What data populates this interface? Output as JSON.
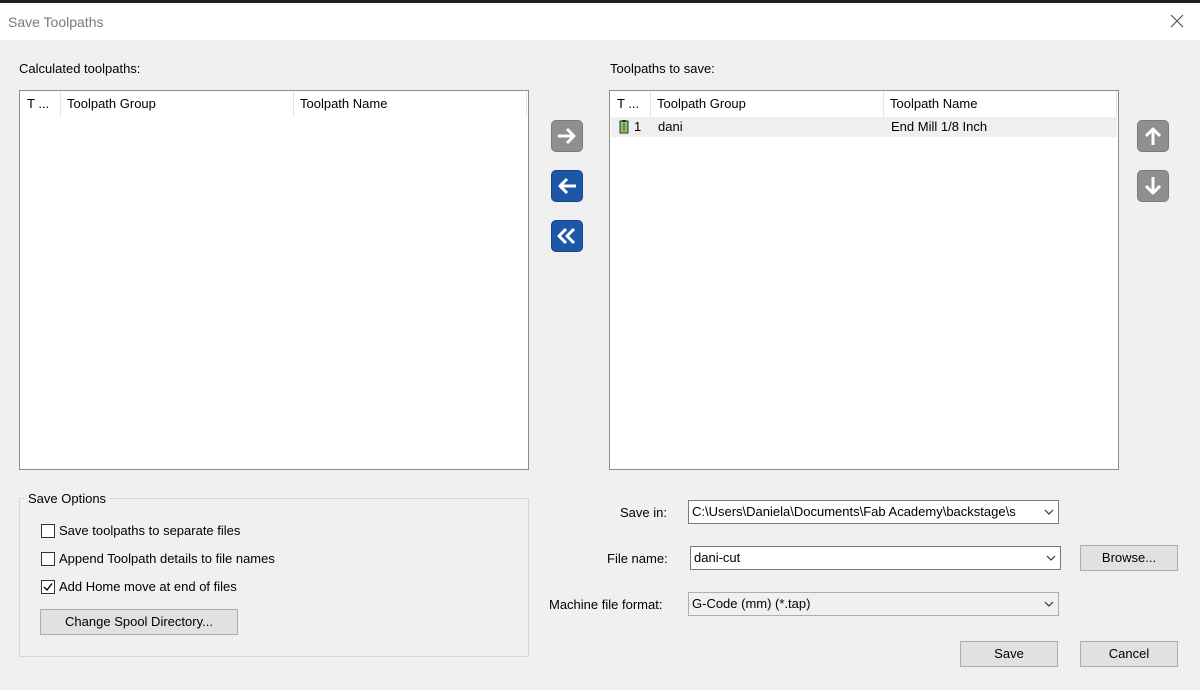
{
  "window": {
    "title": "Save Toolpaths"
  },
  "calculated": {
    "label": "Calculated toolpaths:",
    "columns": [
      "T ...",
      "Toolpath Group",
      "Toolpath Name"
    ]
  },
  "to_save": {
    "label": "Toolpaths to save:",
    "columns": [
      "T ...",
      "Toolpath Group",
      "Toolpath Name"
    ],
    "rows": [
      {
        "tool": "1",
        "group": "dani",
        "name": "End Mill 1/8 Inch"
      }
    ]
  },
  "options": {
    "title": "Save Options",
    "separate_files": {
      "label": "Save toolpaths to separate files",
      "checked": false
    },
    "append_details": {
      "label": "Append Toolpath details to file names",
      "checked": false
    },
    "home_move": {
      "label": "Add Home move at end of files",
      "checked": true
    },
    "spool_button": "Change Spool Directory..."
  },
  "save_in": {
    "label": "Save in:",
    "value": "C:\\Users\\Daniela\\Documents\\Fab Academy\\backstage\\s"
  },
  "file_name": {
    "label": "File name:",
    "value": "dani-cut"
  },
  "browse_button": "Browse...",
  "format": {
    "label": "Machine file format:",
    "value": "G-Code (mm) (*.tap)"
  },
  "save_button": "Save",
  "cancel_button": "Cancel",
  "icons": {
    "move_right": "arrow-right-icon",
    "move_left": "arrow-left-icon",
    "move_all_left": "double-chevron-left-icon",
    "move_up": "arrow-up-icon",
    "move_down": "arrow-down-icon",
    "tool": "tool-holder-icon",
    "close": "close-icon"
  },
  "colors": {
    "accent_blue": "#1d58a8",
    "disabled_gray": "#8f8f8f"
  }
}
